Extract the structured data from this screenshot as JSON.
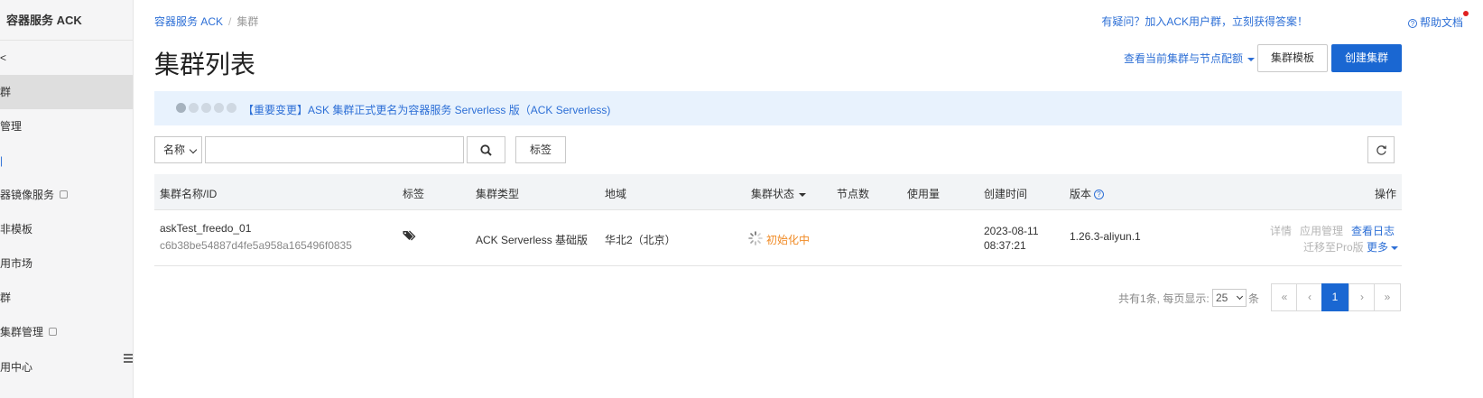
{
  "sidebar": {
    "title": "容器服务 ACK",
    "items": [
      {
        "label": "<"
      },
      {
        "label": "群"
      },
      {
        "label": "管理"
      },
      {
        "label": "|"
      },
      {
        "label": "器镜像服务"
      },
      {
        "label": "非模板"
      },
      {
        "label": "用市场"
      },
      {
        "label": "群"
      },
      {
        "label": "集群管理"
      },
      {
        "label": "用中心"
      }
    ]
  },
  "header": {
    "breadcrumb_root": "容器服务 ACK",
    "breadcrumb_sep": "/",
    "breadcrumb_current": "集群",
    "help_link": "有疑问？加入ACK用户群，立刻获得答案！",
    "help_doc": "帮助文档",
    "page_title": "集群列表",
    "quota_link": "查看当前集群与节点配额",
    "template_button": "集群模板",
    "create_button": "创建集群"
  },
  "notice": {
    "text": "【重要变更】ASK 集群正式更名为容器服务 Serverless 版（ACK Serverless)"
  },
  "filter": {
    "select_value": "名称",
    "search_placeholder": "",
    "tag_button": "标签"
  },
  "table": {
    "headers": {
      "name": "集群名称/ID",
      "tags": "标签",
      "type": "集群类型",
      "region": "地域",
      "status": "集群状态",
      "nodes": "节点数",
      "usage": "使用量",
      "created": "创建时间",
      "version": "版本",
      "actions": "操作"
    },
    "rows": [
      {
        "name": "askTest_freedo_01",
        "id": "c6b38be54887d4fe5a958a165496f0835",
        "type": "ACK Serverless 基础版",
        "region": "华北2（北京）",
        "status": "初始化中",
        "created_date": "2023-08-11",
        "created_time": "08:37:21",
        "version": "1.26.3-aliyun.1",
        "actions": {
          "detail": "详情",
          "app_manage": "应用管理",
          "logs": "查看日志",
          "migrate": "迁移至Pro版",
          "more": "更多"
        }
      }
    ]
  },
  "pagination": {
    "total_text": "共有1条, 每页显示:",
    "page_size": "25",
    "unit": "条",
    "first": "«",
    "prev": "‹",
    "current": "1",
    "next": "›",
    "last": "»"
  },
  "colors": {
    "primary": "#1a67d2",
    "link": "#2d6fd6",
    "status_init": "#f08a24",
    "notice_bg": "#e8f2fd"
  }
}
